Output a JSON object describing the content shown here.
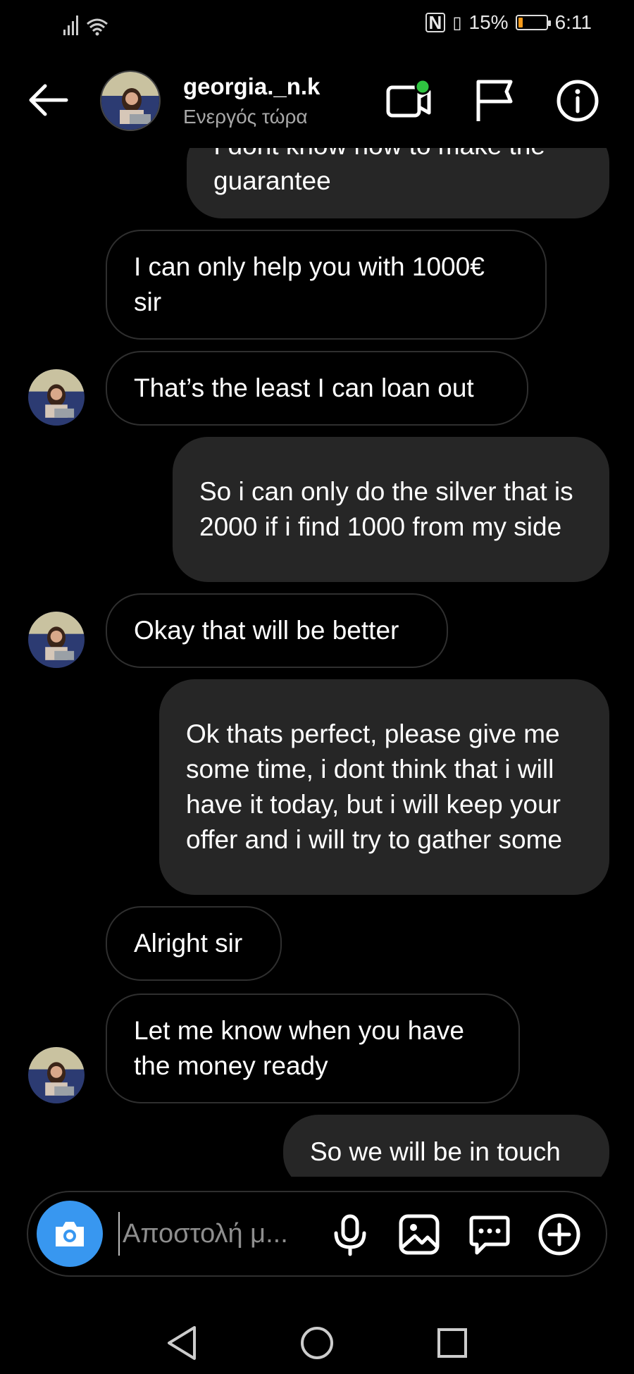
{
  "status_bar": {
    "battery_percent": "15%",
    "battery_level": 0.15,
    "time": "6:11"
  },
  "header": {
    "username": "georgia._n.k",
    "status": "Ενεργός τώρα"
  },
  "messages": [
    {
      "side": "out",
      "text": "I dont know how to make the guarantee"
    },
    {
      "side": "in",
      "text": "I can only help you with 1000€ sir"
    },
    {
      "side": "in",
      "text": "That’s the least I can loan out"
    },
    {
      "side": "out",
      "text": "So i can only do the silver that is 2000 if i find 1000 from my side"
    },
    {
      "side": "in",
      "text": "Okay that will be better"
    },
    {
      "side": "out",
      "text": "Ok thats perfect, please give me some time, i dont think that i will have it today, but i will keep your offer and i will try to gather some"
    },
    {
      "side": "in",
      "text": "Alright sir"
    },
    {
      "side": "in",
      "text": "Let me know when you have the money ready"
    },
    {
      "side": "out",
      "text": "So we will be in touch"
    }
  ],
  "composer": {
    "placeholder": "Αποστολή μ..."
  },
  "icons": {
    "back": "arrow-left-icon",
    "video": "video-call-icon",
    "flag": "flag-icon",
    "info": "info-icon",
    "camera": "camera-icon",
    "mic": "microphone-icon",
    "gallery": "image-icon",
    "sticker": "chat-bubble-icon",
    "plus": "plus-icon"
  },
  "colors": {
    "accent": "#3897f0",
    "online": "#2fc440",
    "bubble_out": "#262626",
    "battery": "#f59a1b"
  }
}
